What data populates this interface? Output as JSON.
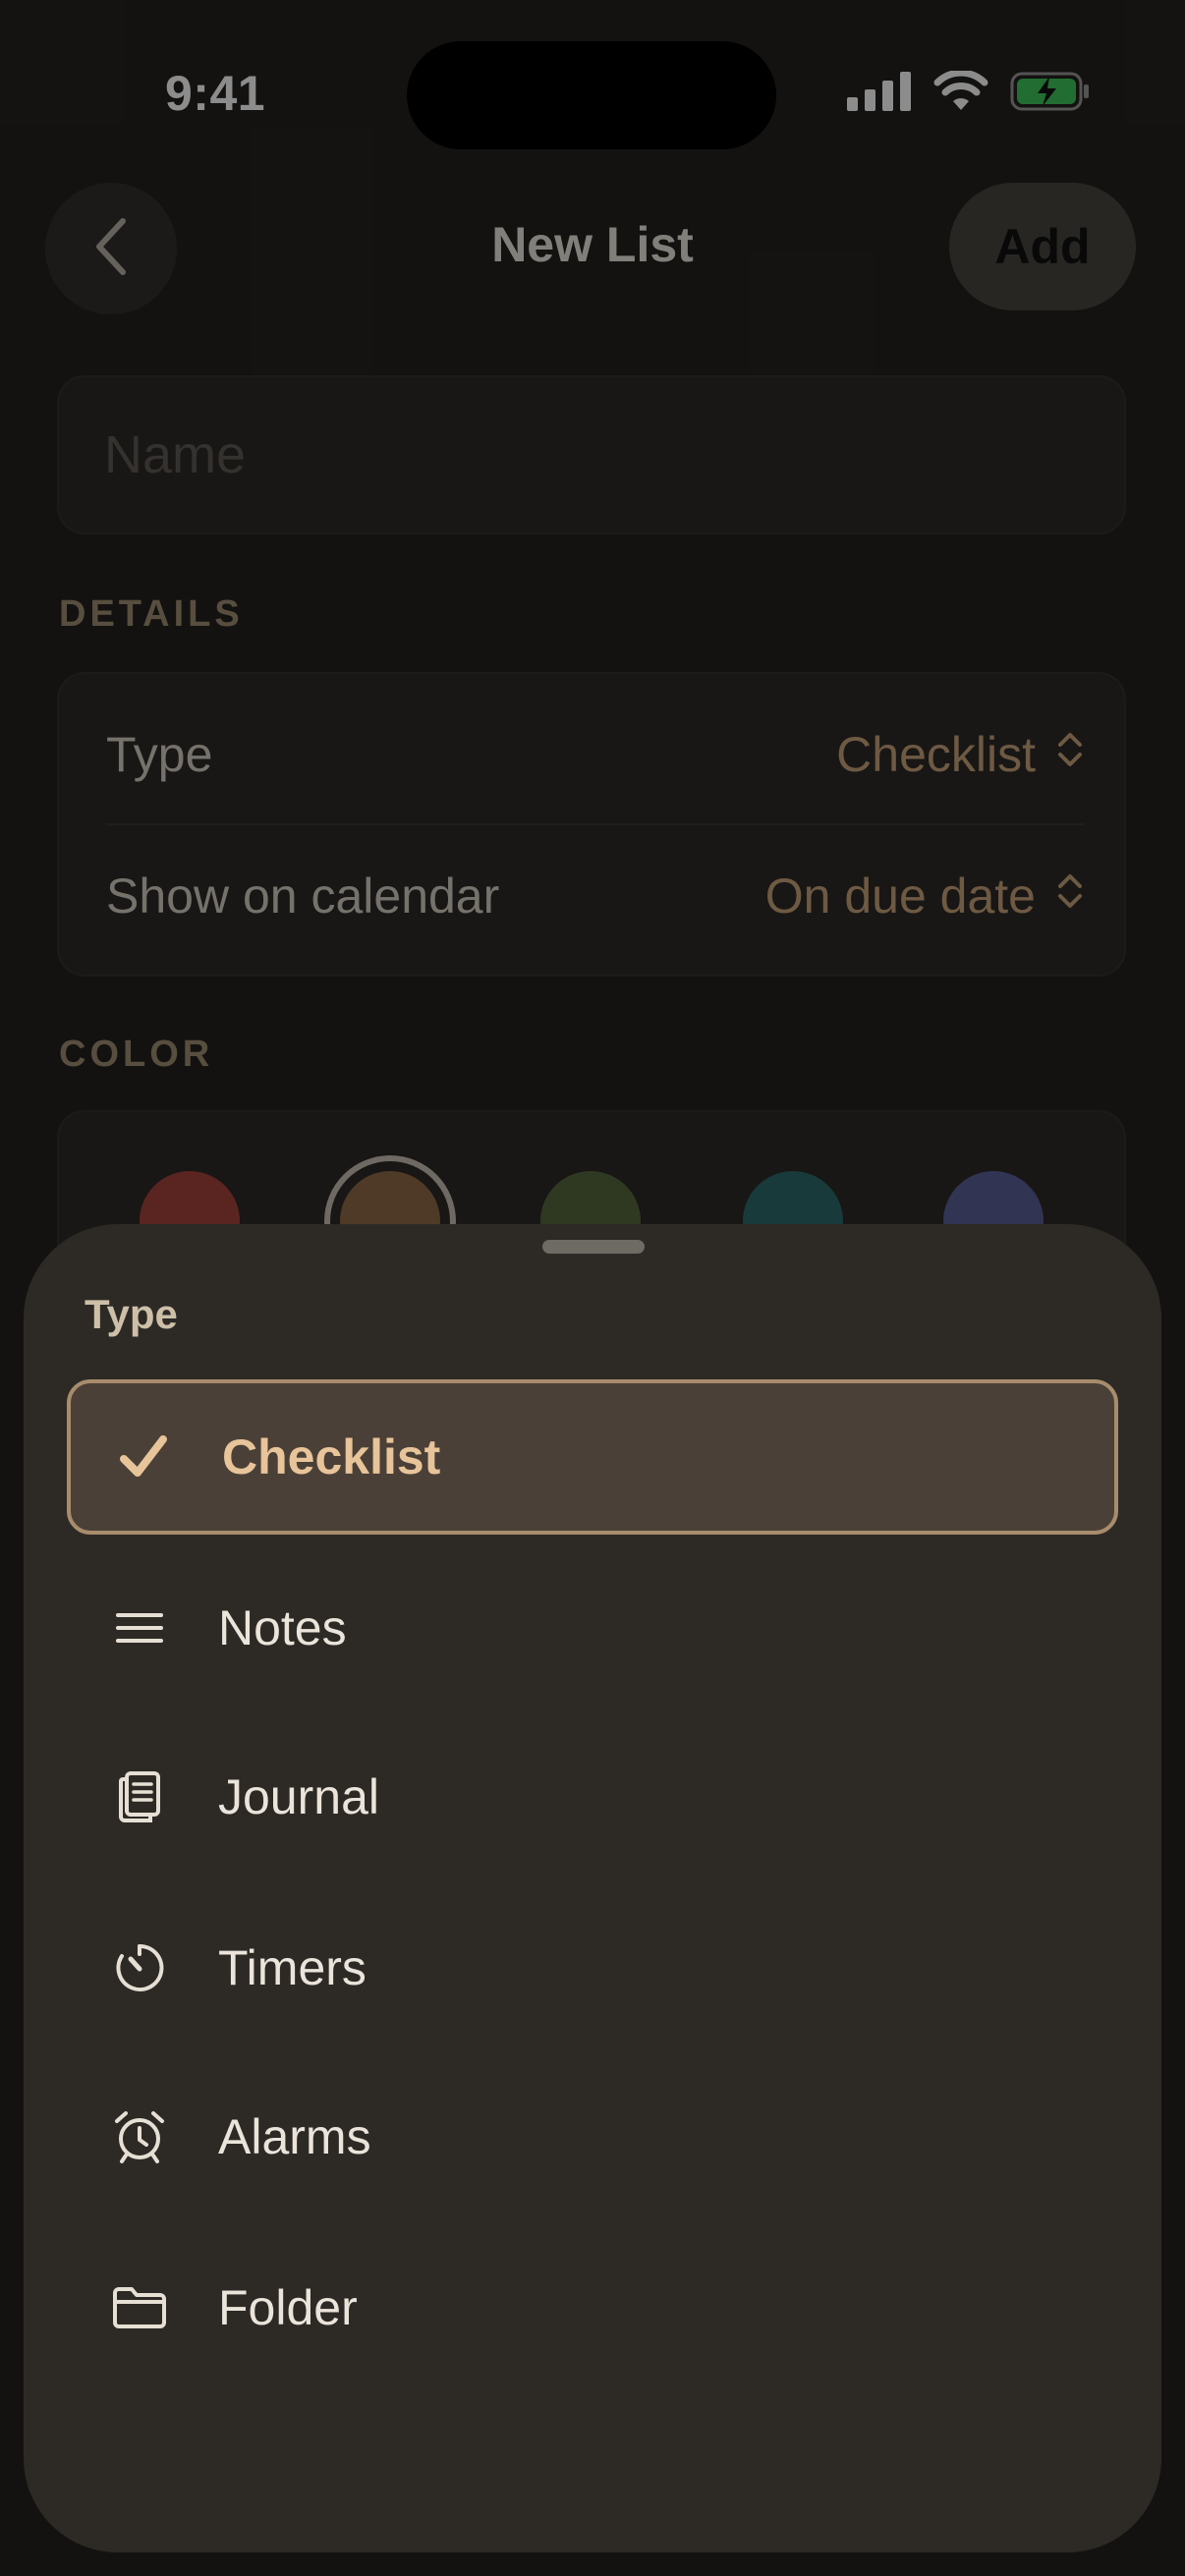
{
  "status_bar": {
    "time": "9:41"
  },
  "nav": {
    "title": "New List",
    "add_label": "Add"
  },
  "name_field": {
    "placeholder": "Name",
    "value": ""
  },
  "details": {
    "header": "DETAILS",
    "type_label": "Type",
    "type_value": "Checklist",
    "calendar_label": "Show on calendar",
    "calendar_value": "On due date"
  },
  "color": {
    "header": "COLOR",
    "swatches": [
      "#a5443b",
      "#8f6a48",
      "#56693f",
      "#2f6b6a",
      "#5a5f98"
    ],
    "selected_index": 1
  },
  "sheet": {
    "title": "Type",
    "options": [
      {
        "label": "Checklist",
        "icon": "checkmark-icon",
        "selected": true
      },
      {
        "label": "Notes",
        "icon": "lines-icon",
        "selected": false
      },
      {
        "label": "Journal",
        "icon": "journal-icon",
        "selected": false
      },
      {
        "label": "Timers",
        "icon": "timer-icon",
        "selected": false
      },
      {
        "label": "Alarms",
        "icon": "alarm-icon",
        "selected": false
      },
      {
        "label": "Folder",
        "icon": "folder-icon",
        "selected": false
      }
    ]
  },
  "colors": {
    "accent": "#c9a27b",
    "sheet_bg": "#2d2a26",
    "selected_border": "#a88c6c"
  }
}
